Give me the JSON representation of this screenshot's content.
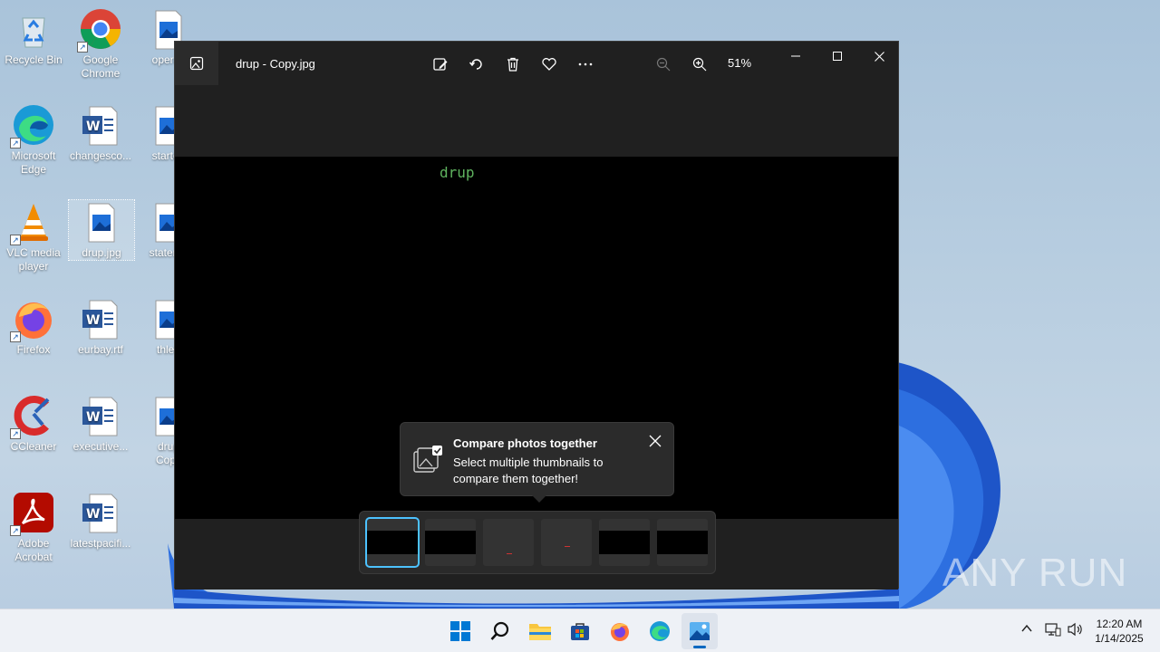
{
  "desktop": {
    "icons": [
      {
        "label": "Recycle Bin"
      },
      {
        "label": "Google Chrome"
      },
      {
        "label": "operati"
      },
      {
        "label": "Microsoft Edge"
      },
      {
        "label": "changesco..."
      },
      {
        "label": "started"
      },
      {
        "label": "VLC media player"
      },
      {
        "label": "drup.jpg"
      },
      {
        "label": "stateme"
      },
      {
        "label": "Firefox"
      },
      {
        "label": "eurbay.rtf"
      },
      {
        "label": "thlet."
      },
      {
        "label": "CCleaner"
      },
      {
        "label": "executive..."
      },
      {
        "label": "drup Copy"
      },
      {
        "label": "Adobe Acrobat"
      },
      {
        "label": "latestpacifi..."
      }
    ]
  },
  "window": {
    "title": "drup - Copy.jpg",
    "toolbar": {
      "edit": "edit-image-icon",
      "rotate": "rotate-icon",
      "delete": "delete-icon",
      "favorite": "heart-icon",
      "more": "more-icon",
      "zoom_out": "zoom-out-icon",
      "zoom_in": "zoom-in-icon",
      "zoom_level": "51%"
    },
    "image_text": "drup",
    "tooltip": {
      "title": "Compare photos together",
      "body": "Select multiple thumbnails to compare them together!"
    },
    "filmstrip": {
      "selected_index": 0,
      "count": 6
    }
  },
  "watermark": "ANY RUN",
  "taskbar": {
    "time": "12:20 AM",
    "date": "1/14/2025",
    "accent": "#0067c0"
  }
}
